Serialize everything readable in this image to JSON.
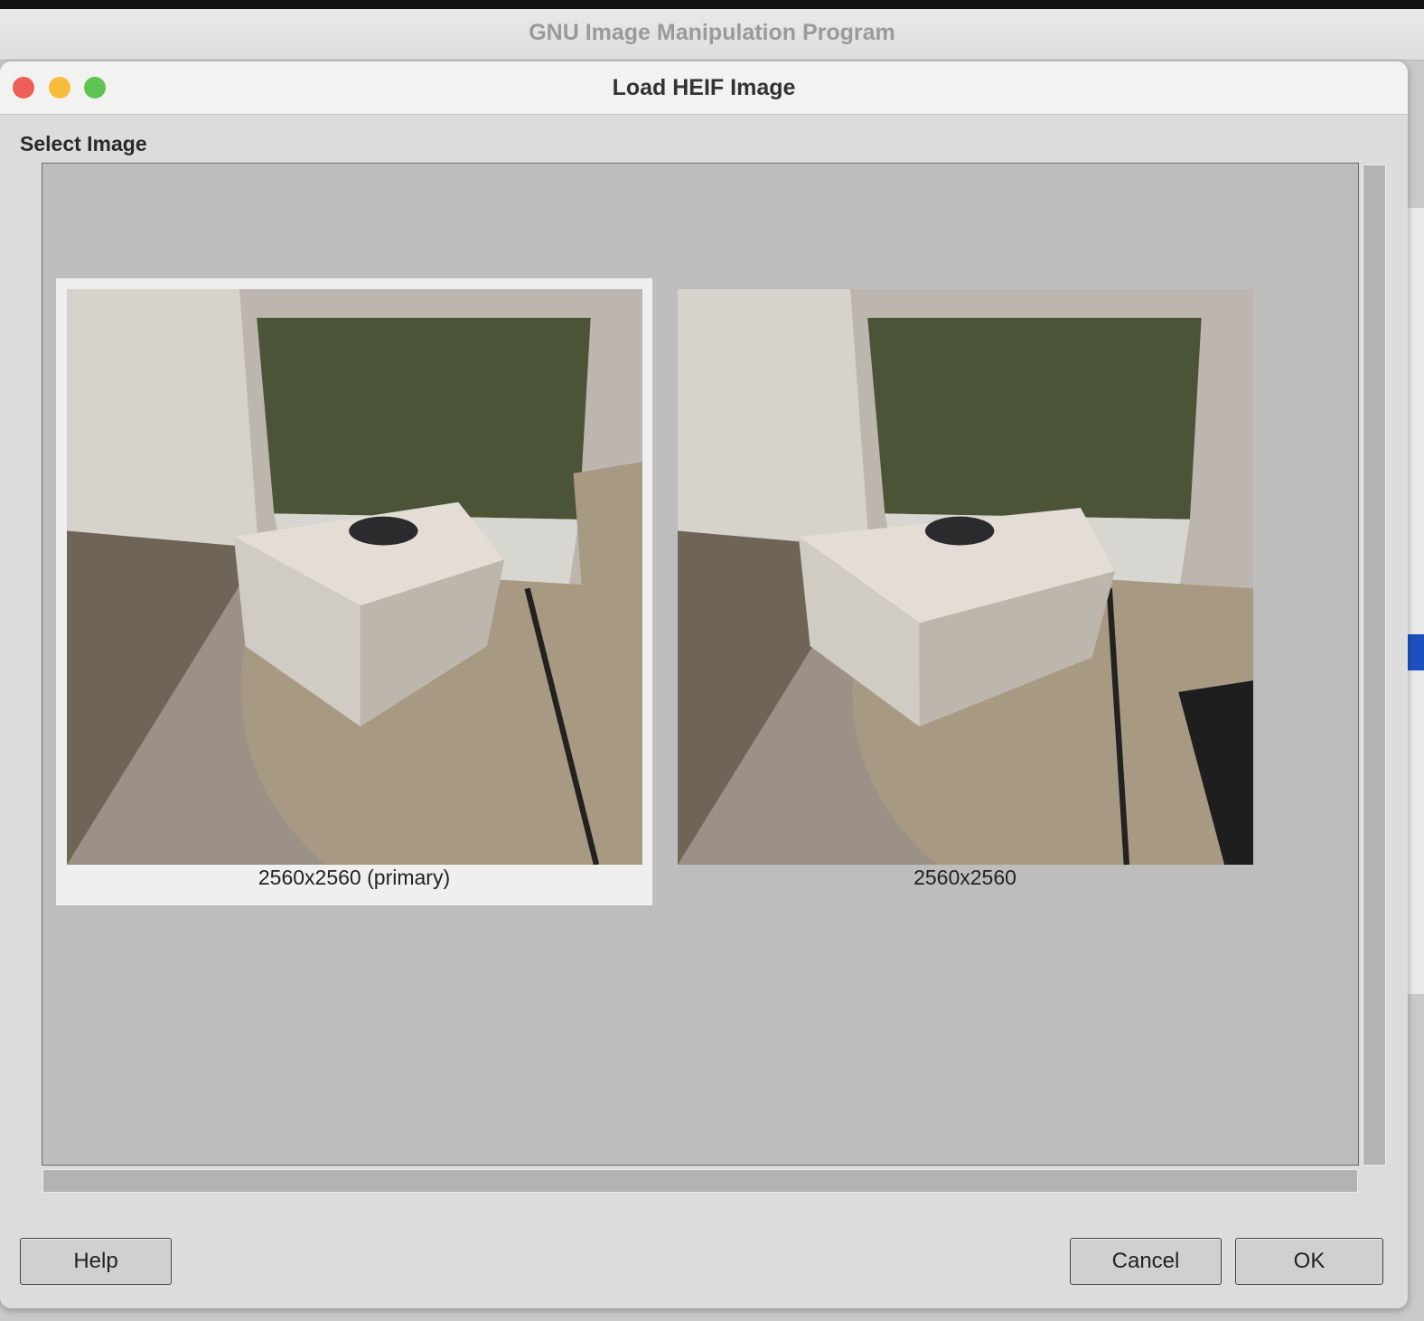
{
  "app_title": "GNU Image Manipulation Program",
  "dialog": {
    "title": "Load HEIF Image",
    "section_label": "Select Image",
    "images": [
      {
        "caption": "2560x2560 (primary)",
        "selected": true
      },
      {
        "caption": "2560x2560",
        "selected": false
      }
    ],
    "buttons": {
      "help": "Help",
      "cancel": "Cancel",
      "ok": "OK"
    }
  },
  "colors": {
    "close": "#ee5f57",
    "minimize": "#f6bd3b",
    "zoom": "#5fc454",
    "selection_bg": "#efefef"
  }
}
